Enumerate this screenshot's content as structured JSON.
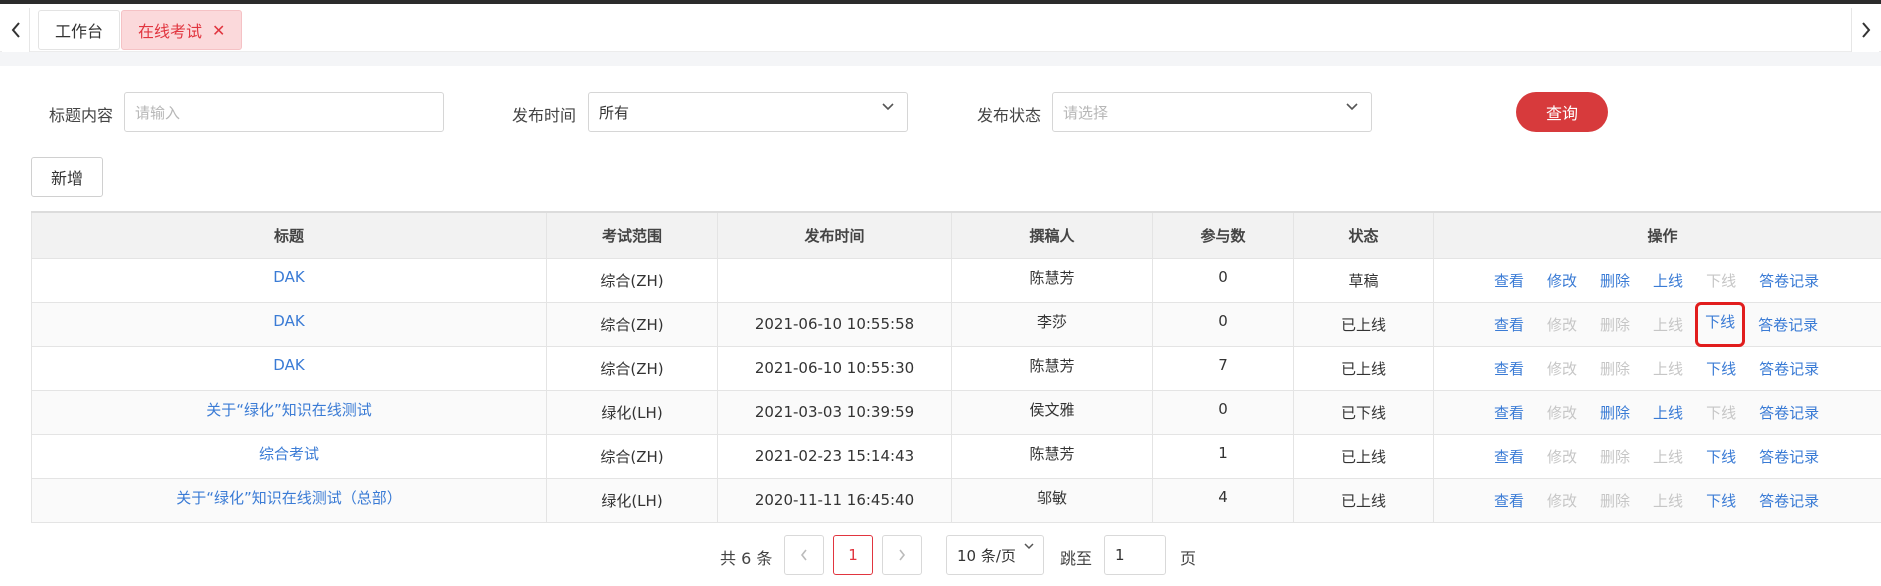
{
  "tabs": {
    "home": "工作台",
    "exam": "在线考试",
    "close_symbol": "✕"
  },
  "filters": {
    "title_label": "标题内容",
    "title_placeholder": "请输入",
    "time_label": "发布时间",
    "time_value": "所有",
    "status_label": "发布状态",
    "status_placeholder": "请选择",
    "query_button": "查询"
  },
  "toolbar": {
    "add_button": "新增"
  },
  "table": {
    "columns": [
      "标题",
      "考试范围",
      "发布时间",
      "撰稿人",
      "参与数",
      "状态",
      "操作"
    ],
    "rows": [
      {
        "title": "DAK",
        "scope": "综合(ZH)",
        "time": "",
        "author": "陈慧芳",
        "count": "0",
        "status": "草稿"
      },
      {
        "title": "DAK",
        "scope": "综合(ZH)",
        "time": "2021-06-10 10:55:58",
        "author": "李莎",
        "count": "0",
        "status": "已上线"
      },
      {
        "title": "DAK",
        "scope": "综合(ZH)",
        "time": "2021-06-10 10:55:30",
        "author": "陈慧芳",
        "count": "7",
        "status": "已上线"
      },
      {
        "title": "关于“绿化”知识在线测试",
        "scope": "绿化(LH)",
        "time": "2021-03-03 10:39:59",
        "author": "侯文雅",
        "count": "0",
        "status": "已下线"
      },
      {
        "title": "综合考试",
        "scope": "综合(ZH)",
        "time": "2021-02-23 15:14:43",
        "author": "陈慧芳",
        "count": "1",
        "status": "已上线"
      },
      {
        "title": "关于“绿化”知识在线测试（总部）",
        "scope": "绿化(LH)",
        "time": "2020-11-11 16:45:40",
        "author": "邬敏",
        "count": "4",
        "status": "已上线"
      }
    ],
    "ops": {
      "view": "查看",
      "edit": "修改",
      "delete": "删除",
      "online": "上线",
      "offline": "下线",
      "records": "答卷记录"
    }
  },
  "pagination": {
    "total": "共 6 条",
    "current_page": "1",
    "page_size": "10 条/页",
    "jump_label": "跳至",
    "jump_value": "1",
    "page_unit": "页"
  },
  "colors": {
    "accent_red": "#d73a3c",
    "link_blue": "#3a7bd5",
    "disabled_gray": "#c6c6c6"
  }
}
